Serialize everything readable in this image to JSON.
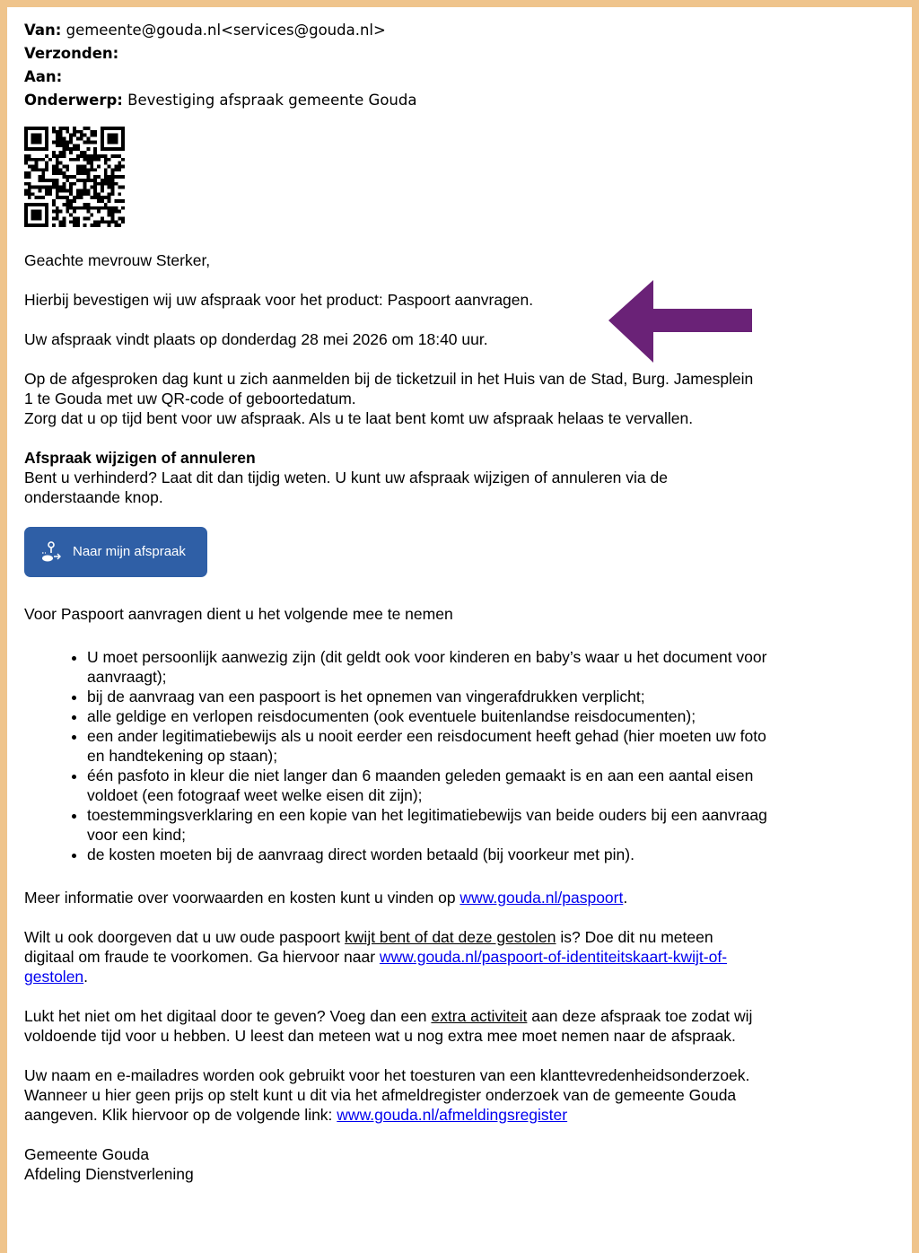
{
  "header": {
    "from_label": "Van:",
    "from_value": "gemeente@gouda.nl<services@gouda.nl>",
    "sent_label": "Verzonden:",
    "to_label": "Aan:",
    "subject_label": "Onderwerp:",
    "subject_value": "Bevestiging afspraak gemeente Gouda"
  },
  "body": {
    "greeting": "Geachte mevrouw Sterker,",
    "confirm": "Hierbij bevestigen wij uw afspraak voor het product: Paspoort aanvragen.",
    "when": "Uw afspraak vindt plaats op donderdag 28 mei 2026  om 18:40 uur.",
    "checkin_1": "Op de afgesproken dag kunt u zich aanmelden bij de ticketzuil in het Huis van de Stad, Burg. Jamesplein",
    "checkin_2": "1 te Gouda met uw QR-code of geboortedatum.",
    "checkin_3": "Zorg dat u op tijd bent voor uw afspraak. Als u te laat bent komt uw afspraak helaas te vervallen.",
    "change_heading": "Afspraak  wijzigen of annuleren",
    "change_text_1": "Bent u verhinderd? Laat dit dan tijdig weten. U kunt uw afspraak wijzigen of annuleren via de",
    "change_text_2": "onderstaande knop.",
    "button_label": "Naar mijn afspraak",
    "bring_intro": "Voor Paspoort aanvragen dient u het volgende mee te nemen",
    "bring_items": [
      [
        "U moet persoonlijk aanwezig zijn (dit geldt ook voor kinderen en baby’s waar u het document voor",
        "aanvraagt);"
      ],
      [
        "bij de aanvraag van een paspoort is het opnemen van vingerafdrukken verplicht;"
      ],
      [
        "alle geldige en verlopen reisdocumenten (ook eventuele buitenlandse reisdocumenten);"
      ],
      [
        "een ander legitimatiebewijs als u nooit eerder een reisdocument heeft gehad (hier moeten uw foto",
        "en handtekening op staan);"
      ],
      [
        "één pasfoto in kleur die niet langer dan 6 maanden geleden gemaakt is en aan een aantal eisen",
        "voldoet (een fotograaf weet welke eisen dit zijn);"
      ],
      [
        "toestemmingsverklaring en een kopie van het legitimatiebewijs van beide ouders bij een aanvraag",
        "voor een kind;"
      ],
      [
        "de kosten moeten bij de aanvraag direct worden betaald (bij voorkeur met pin)."
      ]
    ],
    "info_text": "Meer informatie over voorwaarden en kosten kunt u vinden op ",
    "info_link": "www.gouda.nl/paspoort",
    "info_end": ".",
    "lost_1a": "Wilt u ook doorgeven dat u uw oude paspoort ",
    "lost_1b": "kwijt bent of dat deze gestolen",
    "lost_1c": " is? Doe dit nu meteen",
    "lost_2a": "digitaal om fraude te voorkomen. Ga hiervoor naar ",
    "lost_2b": "www.gouda.nl/paspoort-of-identiteitskaart-kwijt-of-",
    "lost_3": "gestolen",
    "lost_3_end": ".",
    "extra_1a": "Lukt het niet om het digitaal door te geven? Voeg dan een ",
    "extra_1b": "extra activiteit",
    "extra_1c": " aan deze afspraak toe zodat wij",
    "extra_2": "voldoende tijd voor u hebben. U leest dan meteen wat u nog extra mee moet nemen naar de afspraak.",
    "survey_1": "Uw naam en e-mailadres worden ook gebruikt voor het toesturen van een klanttevredenheidsonderzoek.",
    "survey_2": "Wanneer  u hier geen prijs op stelt kunt u dit via het afmeldregister onderzoek van de gemeente Gouda",
    "survey_3a": "aangeven. Klik hiervoor op de volgende link: ",
    "survey_3b": "www.gouda.nl/afmeldingsregister",
    "sign_1": "Gemeente  Gouda",
    "sign_2": "Afdeling Dienstverlening"
  },
  "colors": {
    "frame": "#efc48c",
    "button": "#2f5fa6",
    "arrow": "#6a2277",
    "link": "#0000ee"
  }
}
